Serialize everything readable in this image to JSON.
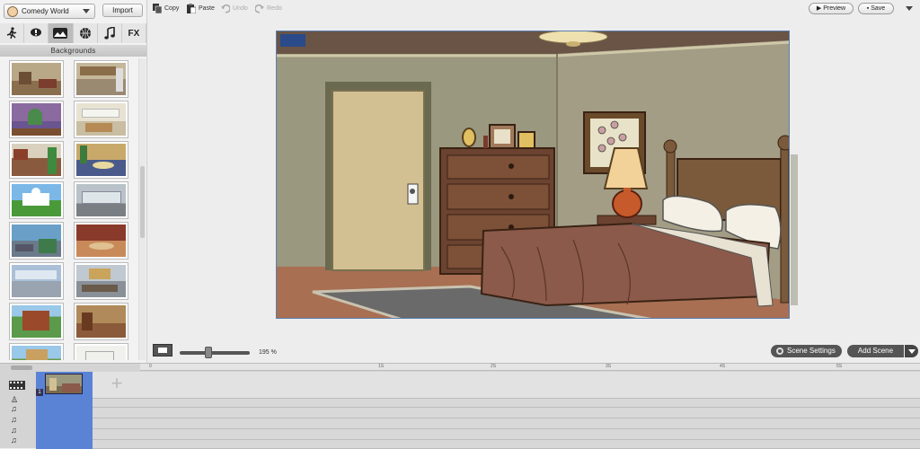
{
  "sidebar": {
    "theme_label": "Comedy World",
    "import_label": "Import",
    "categories": [
      "char",
      "prop",
      "bg",
      "ball",
      "music",
      "FX"
    ],
    "fx_label": "FX",
    "section_title": "Backgrounds",
    "thumbnails": [
      "living-room",
      "kitchen",
      "hallway-green",
      "kitchen-white",
      "office",
      "lobby-plants",
      "white-house",
      "subway",
      "park-city",
      "restaurant",
      "gym",
      "office-desks",
      "school-building",
      "lounge",
      "campus",
      "classroom"
    ]
  },
  "toolbar": {
    "copy": "Copy",
    "paste": "Paste",
    "undo": "Undo",
    "redo": "Redo",
    "preview": "Preview",
    "save": "Save"
  },
  "stage": {
    "zoom": "195 %",
    "scene_settings": "Scene Settings",
    "add_scene": "Add Scene"
  },
  "timeline": {
    "ticks": [
      "0",
      "1S",
      "2S",
      "3S",
      "4S",
      "5S",
      "6S"
    ],
    "scene_count_label": "1"
  },
  "colors": {
    "accent": "#5a83d6",
    "button_dark": "#555555"
  }
}
